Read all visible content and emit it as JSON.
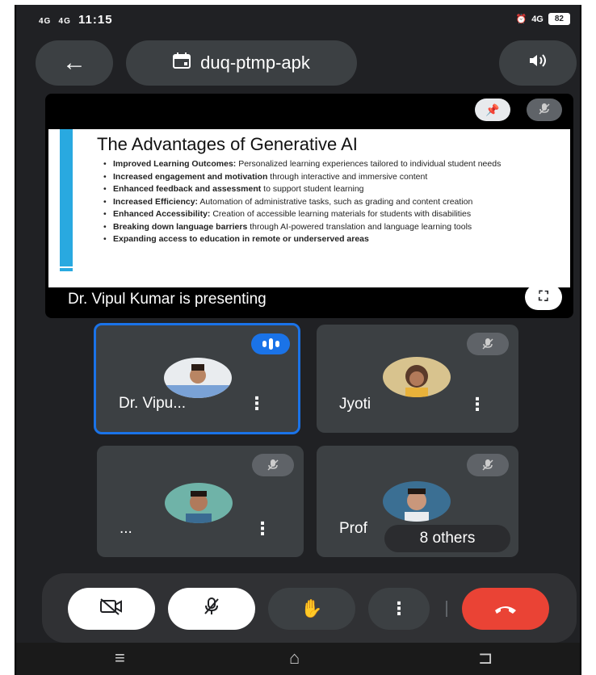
{
  "status_bar": {
    "signal_1": "4G",
    "signal_2": "4G",
    "time": "11:15",
    "right_network": "4G",
    "battery": "82"
  },
  "top_bar": {
    "meeting_code": "duq-ptmp-apk"
  },
  "presentation": {
    "slide_title": "The Advantages of Generative AI",
    "bullets": [
      {
        "bold": "Improved Learning Outcomes:",
        "text": " Personalized learning experiences tailored to individual student needs"
      },
      {
        "bold": "Increased engagement and motivation",
        "text": " through interactive and immersive content"
      },
      {
        "bold": "Enhanced feedback and assessment",
        "text": " to support student learning"
      },
      {
        "bold": "Increased Efficiency:",
        "text": " Automation of administrative tasks, such as grading and content creation"
      },
      {
        "bold": "Enhanced Accessibility:",
        "text": " Creation of accessible learning materials for students with disabilities"
      },
      {
        "bold": "Breaking down language barriers",
        "text": " through AI-powered translation and language learning tools"
      },
      {
        "bold": "Expanding access to education in remote or underserved areas",
        "text": ""
      }
    ],
    "presenting_label": "Dr. Vipul Kumar is presenting"
  },
  "participants": [
    {
      "name": "Dr. Vipu...",
      "state": "speaking"
    },
    {
      "name": "Jyoti",
      "state": "muted"
    },
    {
      "name": "...",
      "state": "muted"
    },
    {
      "name": "Prof",
      "state": "muted"
    }
  ],
  "others_chip": "8 others",
  "colors": {
    "background": "#202124",
    "tile": "#3c4043",
    "active_border": "#1a73e8",
    "end_call": "#ea4335",
    "slide_accent": "#29a9e0"
  }
}
